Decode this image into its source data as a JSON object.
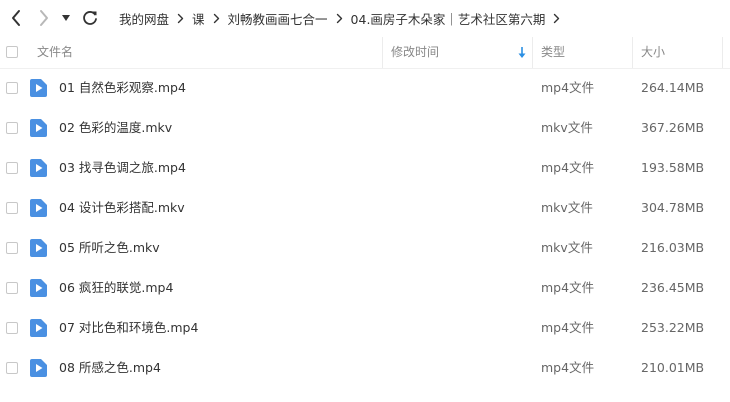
{
  "nav": {
    "back_icon": "chevron-left-icon",
    "forward_icon": "chevron-right-icon",
    "history_icon": "caret-down-icon",
    "refresh_icon": "refresh-icon",
    "breadcrumb": [
      "我的网盘",
      "课",
      "刘畅教画画七合一",
      "04.画房子木朵家｜艺术社区第六期"
    ]
  },
  "header": {
    "name": "文件名",
    "mtime": "修改时间",
    "type": "类型",
    "size": "大小",
    "sort_icon": "sort-down-arrow-icon"
  },
  "colors": {
    "file_icon": "#4a90e2",
    "sort_arrow": "#2b8fe3",
    "text": "#333333",
    "muted": "#888888"
  },
  "files": [
    {
      "name": "01 自然色彩观察.mp4",
      "type": "mp4文件",
      "size": "264.14MB",
      "icon": "video-file-icon"
    },
    {
      "name": "02 色彩的温度.mkv",
      "type": "mkv文件",
      "size": "367.26MB",
      "icon": "video-file-icon"
    },
    {
      "name": "03 找寻色调之旅.mp4",
      "type": "mp4文件",
      "size": "193.58MB",
      "icon": "video-file-icon"
    },
    {
      "name": "04 设计色彩搭配.mkv",
      "type": "mkv文件",
      "size": "304.78MB",
      "icon": "video-file-icon"
    },
    {
      "name": "05 所听之色.mkv",
      "type": "mkv文件",
      "size": "216.03MB",
      "icon": "video-file-icon"
    },
    {
      "name": "06 疯狂的联觉.mp4",
      "type": "mp4文件",
      "size": "236.45MB",
      "icon": "video-file-icon"
    },
    {
      "name": "07 对比色和环境色.mp4",
      "type": "mp4文件",
      "size": "253.22MB",
      "icon": "video-file-icon"
    },
    {
      "name": "08 所感之色.mp4",
      "type": "mp4文件",
      "size": "210.01MB",
      "icon": "video-file-icon"
    }
  ]
}
